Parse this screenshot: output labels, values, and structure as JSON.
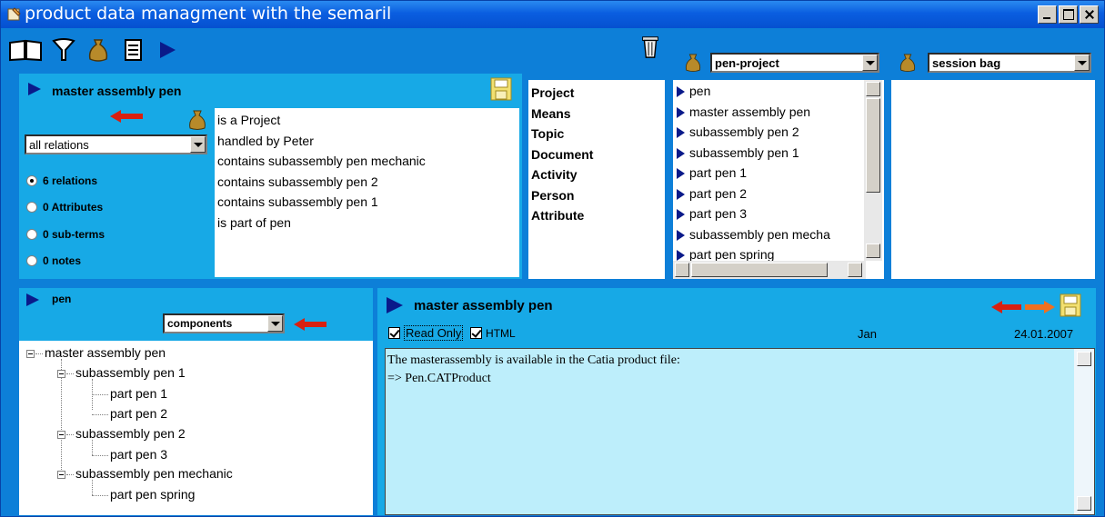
{
  "window": {
    "title": "product data managment with the semaril"
  },
  "toolbar": {
    "icons": [
      "book-icon",
      "filter-icon",
      "bag-icon",
      "document-icon",
      "play-icon",
      "trash-icon"
    ]
  },
  "term_panel": {
    "title": "master assembly pen",
    "relation_filter": "all relations",
    "radios": [
      "6 relations",
      "0 Attributes",
      "0 sub-terms",
      "0 notes"
    ],
    "relations": [
      "is a Project",
      "handled by Peter",
      "contains subassembly pen mechanic",
      "contains subassembly pen 2",
      "contains subassembly pen 1",
      "is part of pen"
    ]
  },
  "categories": [
    "Project",
    "Means",
    "Topic",
    "Document",
    "Activity",
    "Person",
    "Attribute"
  ],
  "project_bag": {
    "selected": "pen-project",
    "items": [
      "pen",
      "master assembly pen",
      "subassembly pen 2",
      "subassembly pen 1",
      "part pen 1",
      "part pen 2",
      "part pen 3",
      "subassembly pen mecha",
      "part pen spring"
    ]
  },
  "session_bag": {
    "selected": "session bag"
  },
  "tree_panel": {
    "title": "pen",
    "view": "components",
    "nodes": {
      "root": "master assembly pen",
      "sub1": "subassembly pen 1",
      "p1": "part pen 1",
      "p2": "part pen 2",
      "sub2": "subassembly pen 2",
      "p3": "part pen 3",
      "sub3": "subassembly pen mechanic",
      "p4": "part pen spring"
    }
  },
  "note_panel": {
    "title": "master assembly pen",
    "read_only_label": "Read Only",
    "html_label": "HTML",
    "author": "Jan",
    "date": "24.01.2007",
    "text_line1": "The masterassembly is available in the Catia product file:",
    "text_line2": "=> Pen.CATProduct"
  },
  "colors": {
    "panel": "#17a9e6",
    "background": "#0d7fd8",
    "arrow": "#0a1a8a",
    "note_bg": "#bdeefb"
  }
}
